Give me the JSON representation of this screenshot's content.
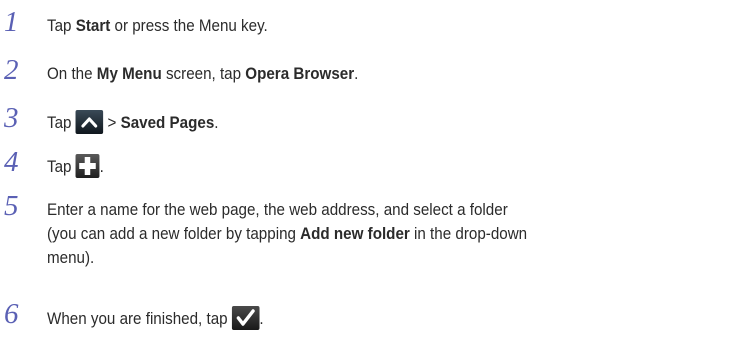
{
  "steps": [
    {
      "num": "1",
      "parts": {
        "p1": "Tap ",
        "b1": "Start",
        "p2": " or press the Menu key."
      }
    },
    {
      "num": "2",
      "parts": {
        "p1": "On the ",
        "b1": "My Menu",
        "p2": " screen, tap ",
        "b2": "Opera Browser",
        "p3": "."
      }
    },
    {
      "num": "3",
      "parts": {
        "p1": "Tap ",
        "icon": "up-arrow-icon",
        "p2": " > ",
        "b1": "Saved Pages",
        "p3": "."
      }
    },
    {
      "num": "4",
      "parts": {
        "p1": "Tap ",
        "icon": "plus-icon",
        "p2": "."
      }
    },
    {
      "num": "5",
      "parts": {
        "line1": "Enter a name for the web page, the web address, and select a folder",
        "p1": "(you can add a new folder by tapping ",
        "b1": "Add new folder",
        "p2": " in the drop-down",
        "line3": "menu)."
      }
    },
    {
      "num": "6",
      "parts": {
        "p1": "When you are finished, tap ",
        "icon": "checkmark-icon",
        "p2": "."
      }
    }
  ],
  "colors": {
    "step_number": "#5a60b4",
    "text": "#2b2b2b"
  }
}
